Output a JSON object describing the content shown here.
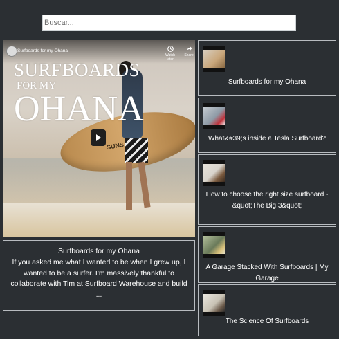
{
  "search": {
    "placeholder": "Buscar..."
  },
  "player": {
    "video_title": "Surfboards for my Ohana",
    "overlay": {
      "line1": "SURFBOARDS",
      "line2": "FOR MY",
      "line3": "OHANA"
    },
    "board_brand": "SUNS",
    "controls": [
      {
        "icon": "watch-later-icon",
        "label": "Watch later"
      },
      {
        "icon": "share-icon",
        "label": "Share"
      }
    ]
  },
  "description": {
    "title": "Surfboards for my Ohana",
    "text": "If you asked me what I wanted to be when I grew up, I wanted to be a surfer. I'm massively thankful to collaborate with Tim at Surfboard Warehouse and build ..."
  },
  "playlist": [
    {
      "title": "Surfboards for my Ohana",
      "thumb_color": "#c9a67a"
    },
    {
      "title": "What&#39;s inside a Tesla Surfboard?",
      "thumb_color": "#8e9aa6"
    },
    {
      "title": "How to choose the right size surfboard - &quot;The Big 3&quot;",
      "thumb_color": "#d8d4cc"
    },
    {
      "title": "A Garage Stacked With Surfboards | My Garage",
      "thumb_color": "#6a7a5a"
    },
    {
      "title": "The Science Of Surfboards",
      "thumb_color": "#c8c2b4"
    }
  ]
}
